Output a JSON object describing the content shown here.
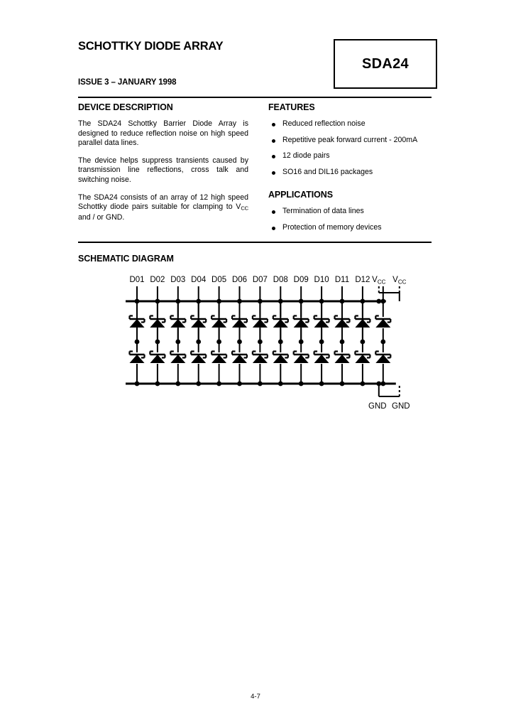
{
  "header": {
    "title": "SCHOTTKY DIODE ARRAY",
    "issue": "ISSUE 3 – JANUARY 1998",
    "part_number": "SDA24"
  },
  "device_description": {
    "heading": "DEVICE DESCRIPTION",
    "paragraphs": [
      "The SDA24 Schottky Barrier Diode Array is designed to reduce reflection noise on high speed parallel data lines.",
      "The device helps suppress transients caused by transmission line reflections, cross talk and switching noise.",
      "The SDA24 consists of an array of 12 high speed Schottky diode pairs suitable for clamping to V"
    ],
    "para3_sub": "CC",
    "para3_tail": " and / or GND."
  },
  "features": {
    "heading": "FEATURES",
    "items": [
      "Reduced reflection noise",
      "Repetitive peak forward current - 200mA",
      "12 diode pairs",
      "SO16 and DIL16 packages"
    ]
  },
  "applications": {
    "heading": "APPLICATIONS",
    "items": [
      "Termination of data lines",
      "Protection of memory devices"
    ]
  },
  "schematic": {
    "heading": "SCHEMATIC DIAGRAM",
    "pin_labels": [
      "D01",
      "D02",
      "D03",
      "D04",
      "D05",
      "D06",
      "D07",
      "D08",
      "D09",
      "D10",
      "D11",
      "D12"
    ],
    "supply_labels": [
      "V",
      "V"
    ],
    "supply_sub": "CC",
    "ground_labels": [
      "GND",
      "GND"
    ],
    "column_count": 13,
    "diode_pairs_per_column": 2,
    "line_color": "#000000"
  },
  "footer": {
    "page_number": "4-7"
  }
}
